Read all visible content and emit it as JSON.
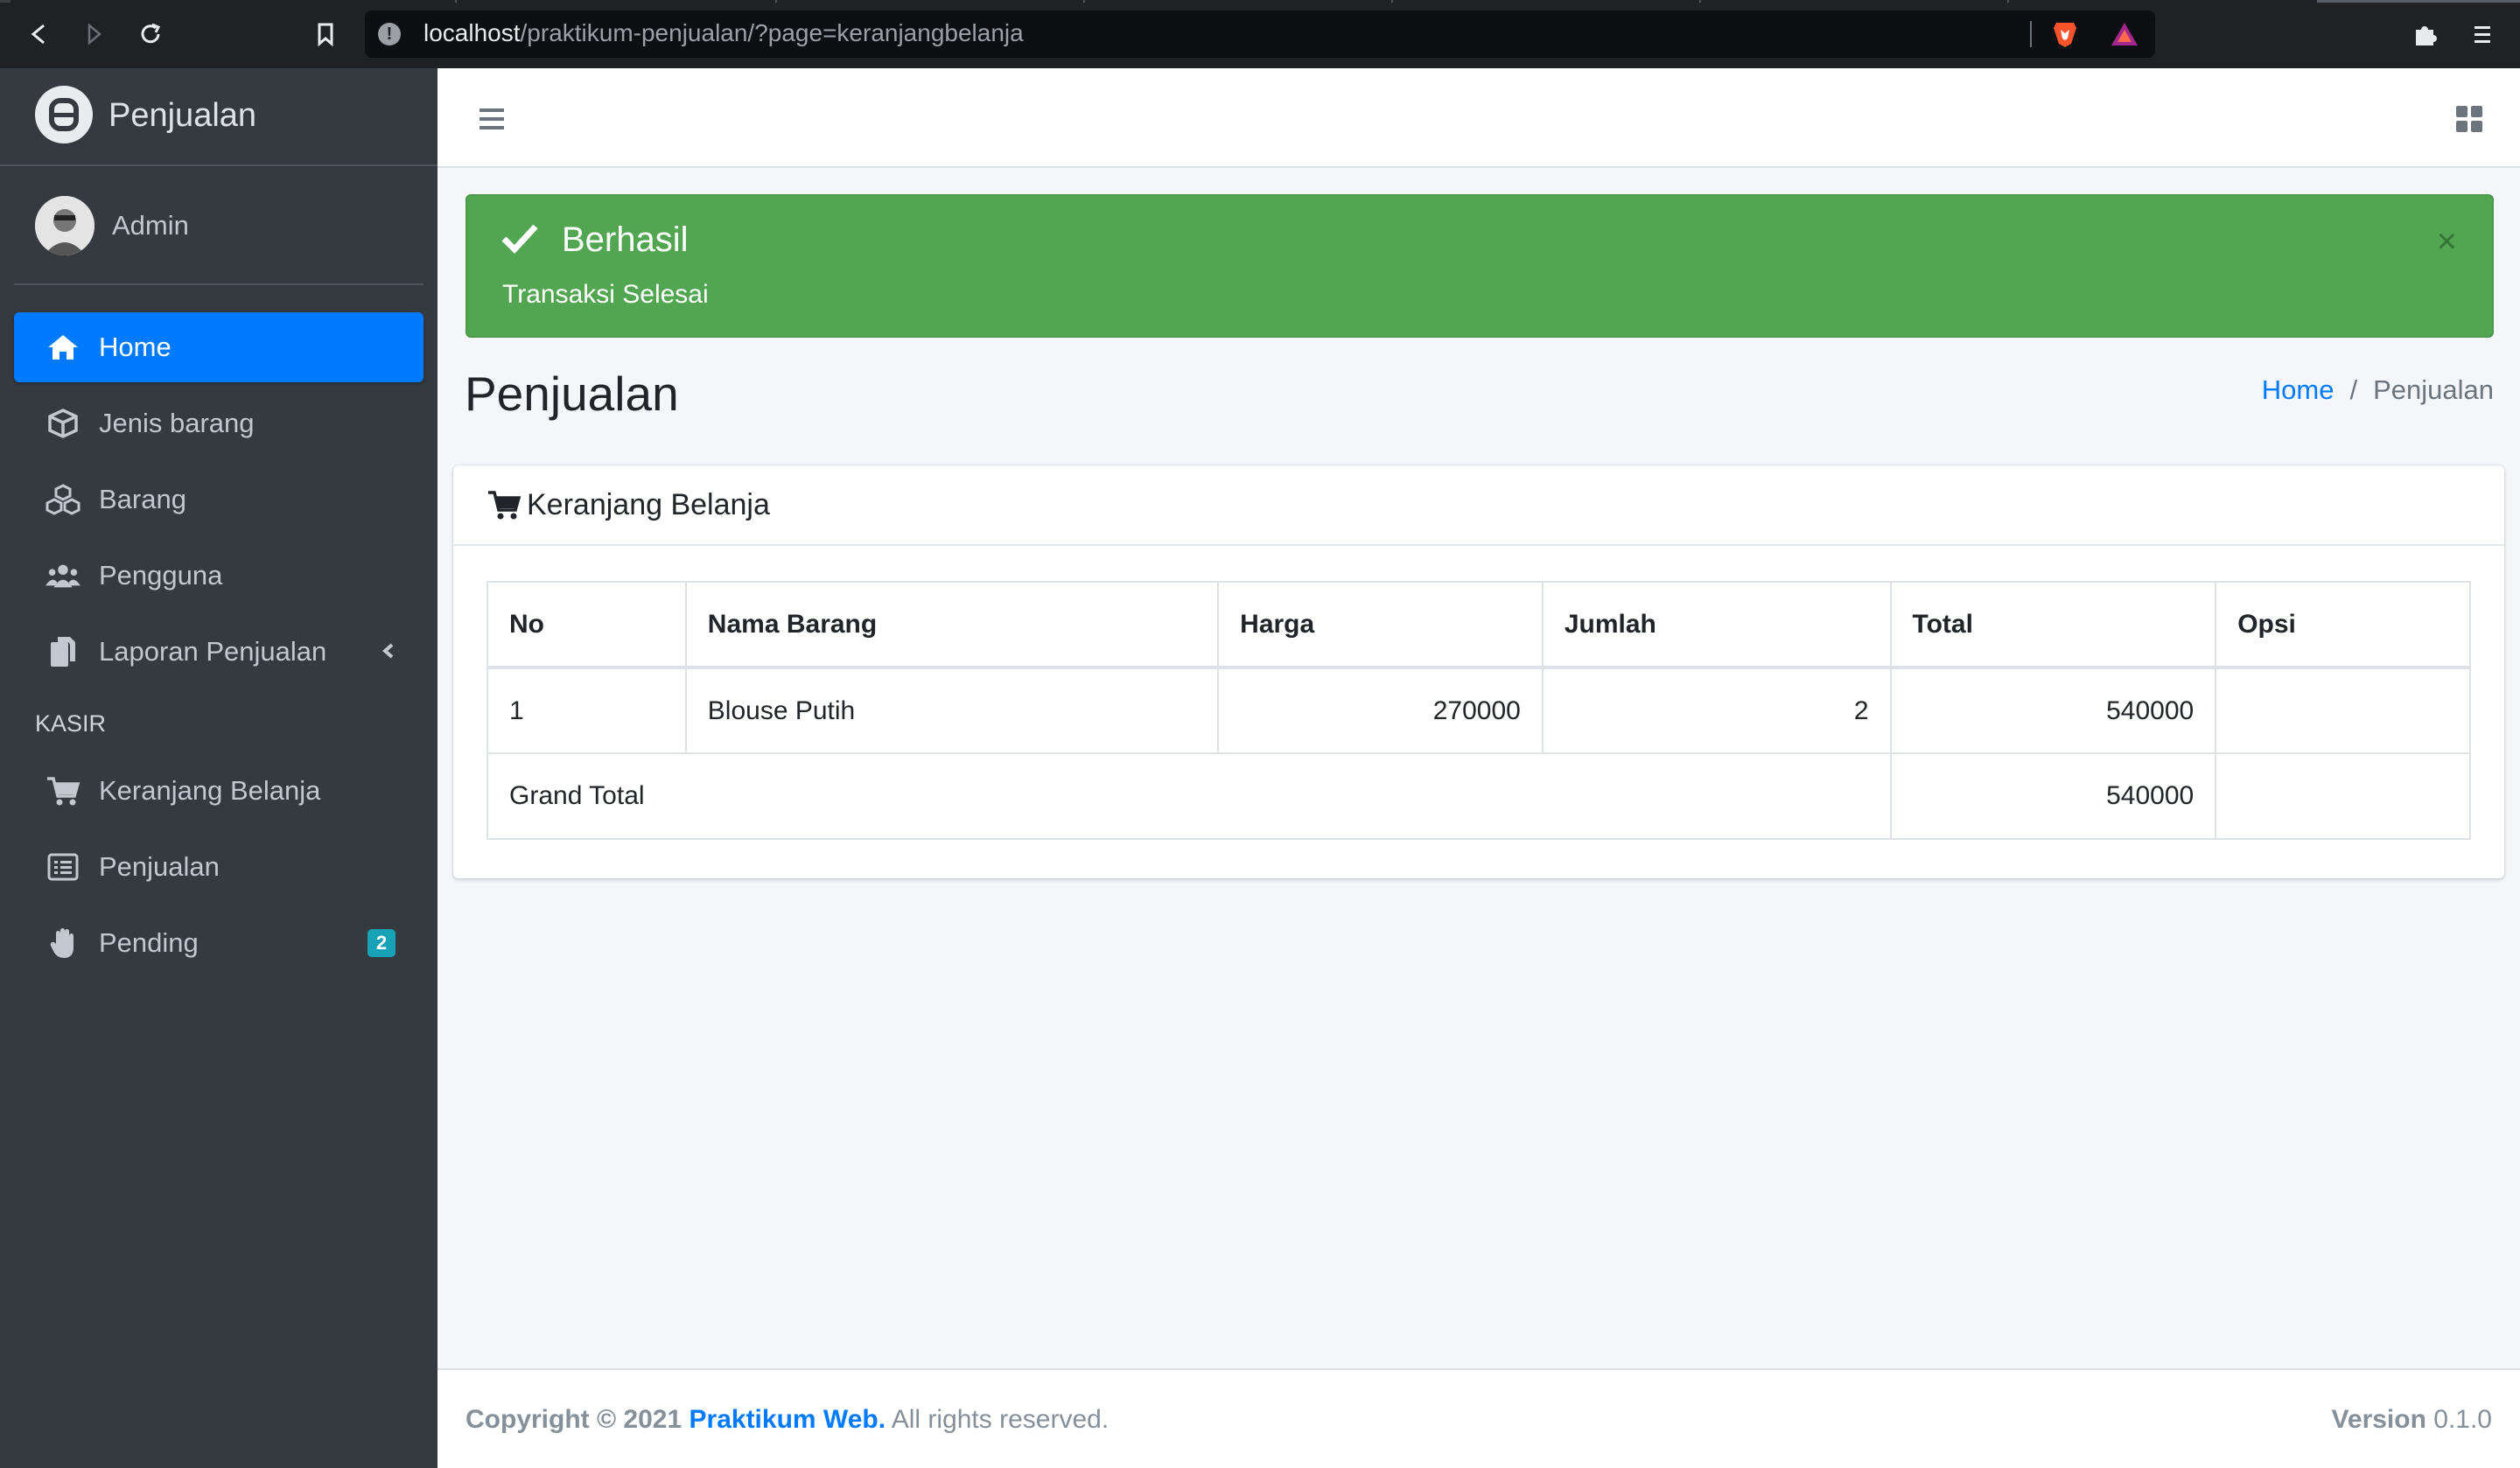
{
  "browser": {
    "url_host": "localhost",
    "url_path": "/praktikum-penjualan/?page=keranjangbelanja"
  },
  "sidebar": {
    "brand": "Penjualan",
    "user": "Admin",
    "items": [
      {
        "label": "Home",
        "icon": "home-icon",
        "active": true
      },
      {
        "label": "Jenis barang",
        "icon": "box-icon"
      },
      {
        "label": "Barang",
        "icon": "boxes-icon"
      },
      {
        "label": "Pengguna",
        "icon": "users-icon"
      },
      {
        "label": "Laporan Penjualan",
        "icon": "copy-icon"
      }
    ],
    "section_header": "KASIR",
    "kasir_items": [
      {
        "label": "Keranjang Belanja",
        "icon": "cart-icon"
      },
      {
        "label": "Penjualan",
        "icon": "list-icon"
      },
      {
        "label": "Pending",
        "icon": "hand-icon",
        "badge": "2"
      }
    ]
  },
  "alert": {
    "title": "Berhasil",
    "message": "Transaksi Selesai",
    "close": "×"
  },
  "content": {
    "title": "Penjualan",
    "breadcrumb": {
      "home": "Home",
      "separator": "/",
      "current": "Penjualan"
    }
  },
  "card": {
    "title": "Keranjang Belanja",
    "table": {
      "headers": [
        "No",
        "Nama Barang",
        "Harga",
        "Jumlah",
        "Total",
        "Opsi"
      ],
      "rows": [
        {
          "no": "1",
          "nama": "Blouse Putih",
          "harga": "270000",
          "jumlah": "2",
          "total": "540000",
          "opsi": ""
        }
      ],
      "grand_total_label": "Grand Total",
      "grand_total_value": "540000"
    }
  },
  "footer": {
    "copyright": "Copyright © 2021",
    "brand_link": "Praktikum Web.",
    "rights": "All rights reserved.",
    "version_label": "Version",
    "version_value": "0.1.0"
  },
  "colors": {
    "sidebar_bg": "#343a40",
    "active": "#007bff",
    "success": "#52a651",
    "badge": "#17a2b8"
  }
}
